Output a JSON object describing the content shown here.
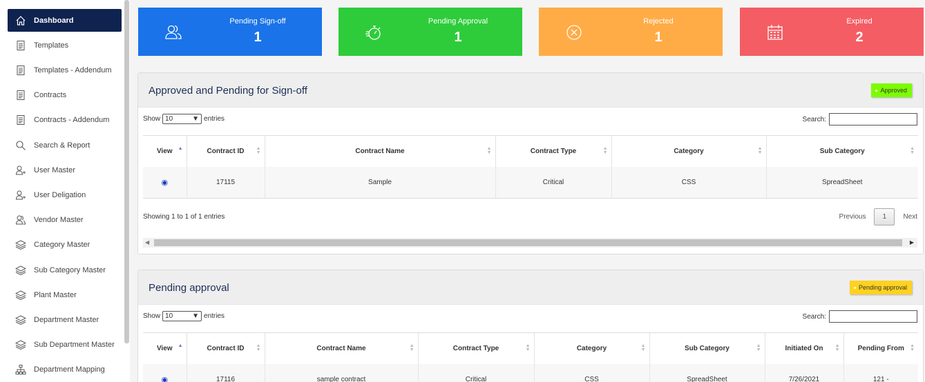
{
  "sidebar": {
    "items": [
      {
        "label": "Dashboard",
        "icon": "home-icon",
        "active": true
      },
      {
        "label": "Templates",
        "icon": "document-icon"
      },
      {
        "label": "Templates - Addendum",
        "icon": "document-icon"
      },
      {
        "label": "Contracts",
        "icon": "document-icon"
      },
      {
        "label": "Contracts - Addendum",
        "icon": "document-icon"
      },
      {
        "label": "Search & Report",
        "icon": "search-icon"
      },
      {
        "label": "User Master",
        "icon": "user-icon"
      },
      {
        "label": "User Deligation",
        "icon": "user-icon"
      },
      {
        "label": "Vendor Master",
        "icon": "users-icon"
      },
      {
        "label": "Category Master",
        "icon": "layers-icon"
      },
      {
        "label": "Sub Category Master",
        "icon": "layers-icon"
      },
      {
        "label": "Plant Master",
        "icon": "layers-icon"
      },
      {
        "label": "Department Master",
        "icon": "layers-icon"
      },
      {
        "label": "Sub Department Master",
        "icon": "layers-icon"
      },
      {
        "label": "Department Mapping",
        "icon": "sitemap-icon"
      }
    ]
  },
  "cards": [
    {
      "title": "Pending Sign-off",
      "value": "1",
      "color": "#1a73e8",
      "icon": "users-icon"
    },
    {
      "title": "Pending Approval",
      "value": "1",
      "color": "#2ecc3a",
      "icon": "stopwatch-icon"
    },
    {
      "title": "Rejected",
      "value": "1",
      "color": "#ffac47",
      "icon": "x-circle-icon"
    },
    {
      "title": "Expired",
      "value": "2",
      "color": "#f45d64",
      "icon": "calendar-icon"
    }
  ],
  "panel1": {
    "title": "Approved and Pending for Sign-off",
    "badge": "Approved",
    "badge_color": "#7cfc00",
    "show_label": "Show",
    "page_size": "10",
    "entries_label": "entries",
    "search_label": "Search:",
    "columns": [
      "View",
      "Contract ID",
      "Contract Name",
      "Contract Type",
      "Category",
      "Sub Category"
    ],
    "rows": [
      {
        "id": "17115",
        "name": "Sample",
        "type": "Critical",
        "category": "CSS",
        "sub_category": "SpreadSheet"
      }
    ],
    "info": "Showing 1 to 1 of 1 entries",
    "prev": "Previous",
    "page": "1",
    "next": "Next"
  },
  "panel2": {
    "title": "Pending approval",
    "badge": "Pending approval",
    "badge_color": "#ffd21f",
    "show_label": "Show",
    "page_size": "10",
    "entries_label": "entries",
    "search_label": "Search:",
    "columns": [
      "View",
      "Contract ID",
      "Contract Name",
      "Contract Type",
      "Category",
      "Sub Category",
      "Initiated On",
      "Pending From"
    ],
    "rows": [
      {
        "id": "17116",
        "name": "sample contract",
        "type": "Critical",
        "category": "CSS",
        "sub_category": "SpreadSheet",
        "initiated": "7/26/2021",
        "pending": "121 -"
      }
    ]
  }
}
